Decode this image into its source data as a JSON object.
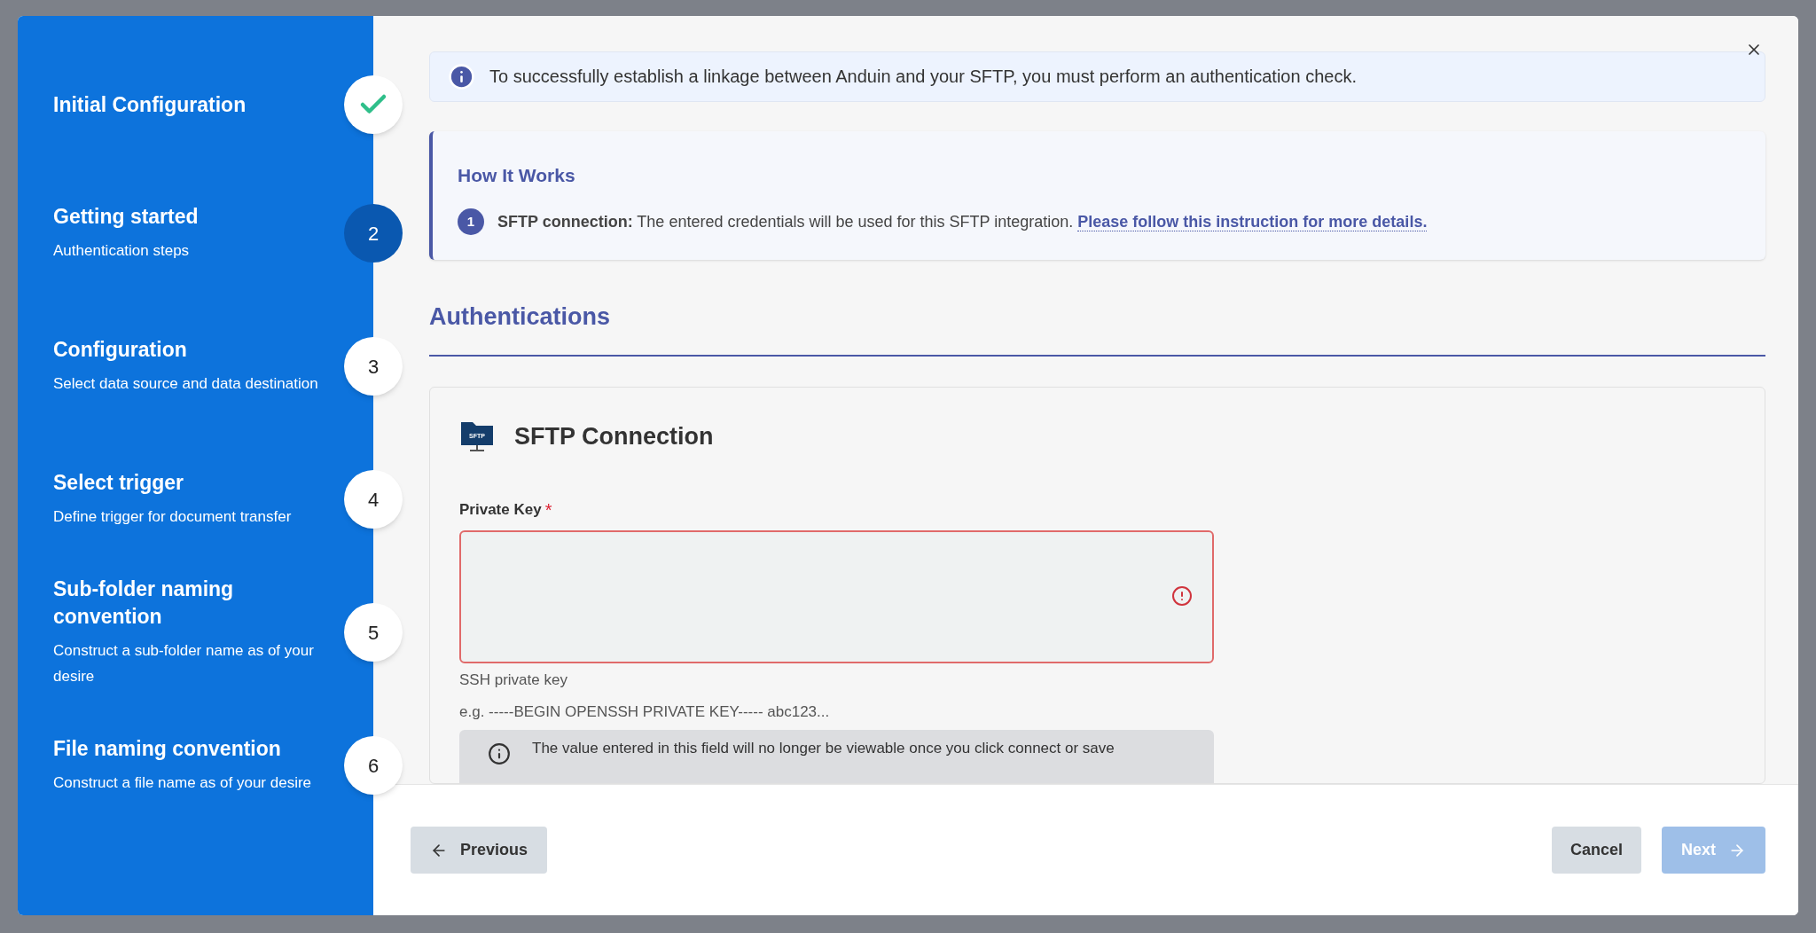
{
  "steps": [
    {
      "title": "Initial Configuration",
      "completed": true,
      "current": false
    },
    {
      "title": "Getting started",
      "subtitle": "Authentication steps",
      "number": "2",
      "completed": false,
      "current": true
    },
    {
      "title": "Configuration",
      "subtitle": "Select data source and data destination",
      "number": "3",
      "completed": false,
      "current": false
    },
    {
      "title": "Select trigger",
      "subtitle": "Define trigger for document transfer",
      "number": "4",
      "completed": false,
      "current": false
    },
    {
      "title": "Sub-folder naming convention",
      "subtitle": "Construct a sub-folder name as of your desire",
      "number": "5",
      "completed": false,
      "current": false
    },
    {
      "title": "File naming convention",
      "subtitle": "Construct a file name as of your desire",
      "number": "6",
      "completed": false,
      "current": false
    }
  ],
  "info_banner": {
    "text": "To successfully establish a linkage between Anduin and your SFTP, you must perform an authentication check."
  },
  "how_it_works": {
    "title": "How It Works",
    "items": [
      {
        "number": "1",
        "text": "**SFTP connection:** The entered credentials will be used for this SFTP integration.",
        "link": "Please follow this instruction for more details."
      }
    ]
  },
  "section_title": "Authentications",
  "connection": {
    "title": "SFTP Connection",
    "icon_label": "SFTP",
    "field": {
      "label": "Private Key",
      "required_mark": "*",
      "error": true,
      "helper": "SSH private key",
      "example": "e.g. -----BEGIN OPENSSH PRIVATE KEY----- abc123..."
    },
    "note": "The value entered in this field will no longer be viewable once you click connect or save"
  },
  "footer": {
    "previous": "Previous",
    "cancel": "Cancel",
    "next": "Next",
    "next_disabled": true
  }
}
